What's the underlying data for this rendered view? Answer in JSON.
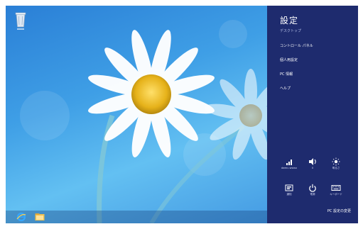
{
  "desktop": {
    "recycle_bin_icon": "recycle-bin-icon",
    "taskbar": {
      "buttons": [
        {
          "icon": "internet-explorer-icon",
          "color": "#ffd24a"
        },
        {
          "icon": "file-explorer-icon",
          "color": "#f2c14e"
        }
      ]
    }
  },
  "settings_charm": {
    "title": "設定",
    "subtitle": "デスクトップ",
    "menu": [
      "コントロール パネル",
      "個人用設定",
      "PC 情報",
      "ヘルプ"
    ],
    "quick_settings_row1": [
      {
        "icon": "network-signal-icon",
        "label": "dwmc-wwwx"
      },
      {
        "icon": "speaker-volume-icon",
        "label": "0"
      },
      {
        "icon": "brightness-sun-icon",
        "label": "明るさ"
      }
    ],
    "quick_settings_row2": [
      {
        "icon": "notifications-icon",
        "label": "通知"
      },
      {
        "icon": "power-icon",
        "label": "電源"
      },
      {
        "icon": "keyboard-icon",
        "label": "キーボード"
      }
    ],
    "change_pc_settings": "PC 設定の変更",
    "background_color": "#1e2b6e"
  }
}
